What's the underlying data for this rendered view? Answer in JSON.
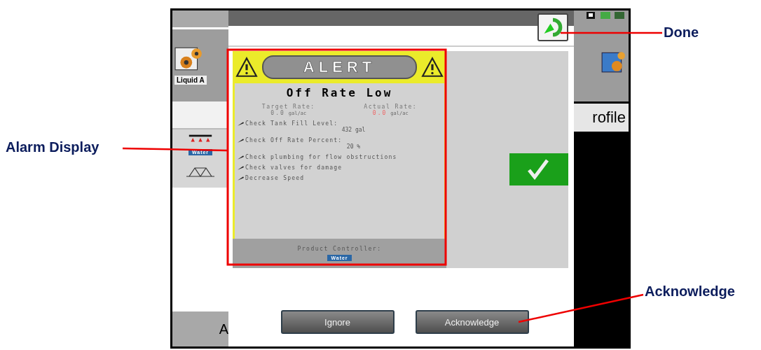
{
  "callouts": [
    {
      "label": "Done"
    },
    {
      "label": "Alarm Display"
    },
    {
      "label": "Acknowledge"
    }
  ],
  "left_panel": {
    "app_label": "Liquid A",
    "product_tag": "Water",
    "bottom_label": "A"
  },
  "dialog": {
    "alert": {
      "banner": "ALERT",
      "title": "Off Rate Low",
      "rates": [
        {
          "label": "Target Rate:",
          "value": "0.0",
          "unit": "gal/ac",
          "kind": "normal"
        },
        {
          "label": "Actual Rate:",
          "value": "0.0",
          "unit": "gal/ac",
          "kind": "warning"
        }
      ],
      "checks": [
        {
          "text": "Check Tank Fill Level:",
          "detail": "432 gal"
        },
        {
          "text": "Check Off Rate Percent:",
          "detail": "20 %"
        },
        {
          "text": "Check plumbing for flow obstructions"
        },
        {
          "text": "Check valves for damage"
        },
        {
          "text": "Decrease Speed"
        }
      ],
      "footer": {
        "label": "Product Controller:",
        "tag": "Water"
      }
    },
    "buttons": [
      {
        "label": "Ignore"
      },
      {
        "label": "Acknowledge"
      }
    ]
  },
  "right_panel": {
    "tab_label": "rofile"
  }
}
